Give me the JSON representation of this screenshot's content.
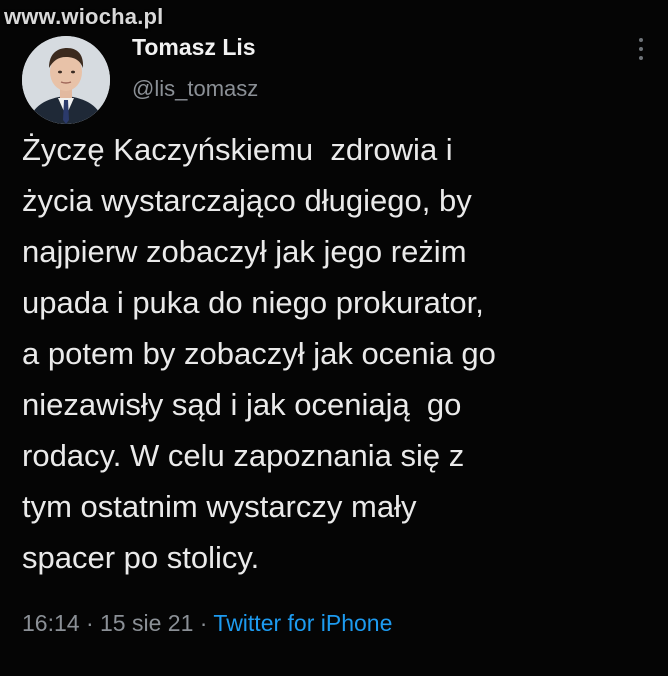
{
  "watermark": "www.wiocha.pl",
  "author": {
    "name": "Tomasz Lis",
    "handle": "@lis_tomasz"
  },
  "tweet": {
    "lines": [
      "Życzę Kaczyńskiemu  zdrowia i",
      "życia wystarczająco długiego, by",
      "najpierw zobaczył jak jego reżim",
      "upada i puka do niego prokurator,",
      "a potem by zobaczył jak ocenia go",
      "niezawisły sąd i jak oceniają  go",
      "rodacy. W celu zapoznania się z",
      "tym ostatnim wystarczy mały",
      "spacer po stolicy."
    ]
  },
  "meta": {
    "time": "16:14",
    "separator": "·",
    "date": "15 sie 21",
    "source": "Twitter for iPhone"
  },
  "colors": {
    "background": "#050505",
    "text": "#eaeaea",
    "muted": "#8b9096",
    "link": "#1d9bf0"
  },
  "icons": {
    "more": "more-vertical-icon"
  }
}
